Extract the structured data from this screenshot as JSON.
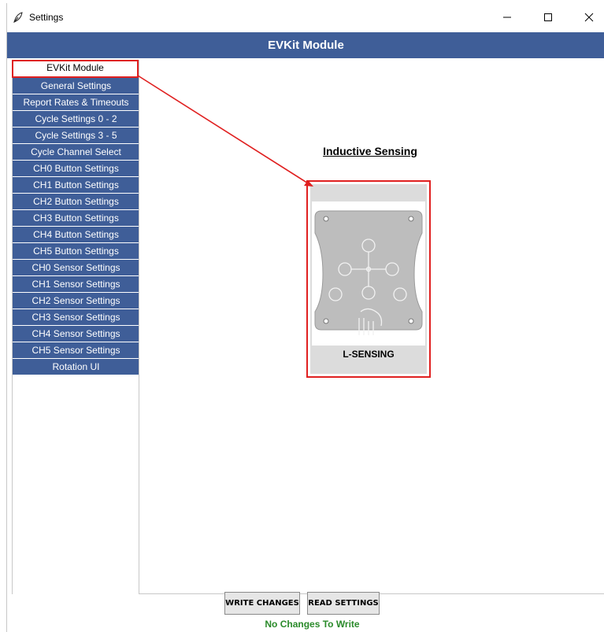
{
  "window": {
    "title": "Settings",
    "icon": "feather-pen-icon",
    "controls": [
      "minimize-icon",
      "maximize-icon",
      "close-icon"
    ]
  },
  "header": {
    "title": "EVKit Module"
  },
  "sidebar": {
    "items": [
      {
        "label": "EVKit Module",
        "active": true
      },
      {
        "label": "General Settings"
      },
      {
        "label": "Report Rates & Timeouts"
      },
      {
        "label": "Cycle Settings 0 - 2"
      },
      {
        "label": "Cycle Settings 3 - 5"
      },
      {
        "label": "Cycle Channel Select"
      },
      {
        "label": "CH0 Button Settings"
      },
      {
        "label": "CH1 Button Settings"
      },
      {
        "label": "CH2 Button Settings"
      },
      {
        "label": "CH3 Button Settings"
      },
      {
        "label": "CH4 Button Settings"
      },
      {
        "label": "CH5 Button Settings"
      },
      {
        "label": "CH0 Sensor Settings"
      },
      {
        "label": "CH1 Sensor Settings"
      },
      {
        "label": "CH2 Sensor Settings"
      },
      {
        "label": "CH3 Sensor Settings"
      },
      {
        "label": "CH4 Sensor Settings"
      },
      {
        "label": "CH5 Sensor Settings"
      },
      {
        "label": "Rotation UI"
      }
    ]
  },
  "main": {
    "section_title": "Inductive Sensing",
    "module_card": {
      "label": "L-SENSING"
    }
  },
  "footer": {
    "write_label": "WRITE CHANGES",
    "read_label": "READ SETTINGS",
    "status": "No Changes To Write"
  },
  "colors": {
    "accent": "#3f5e98",
    "highlight": "#e02020",
    "status_ok": "#2a8a2a"
  }
}
